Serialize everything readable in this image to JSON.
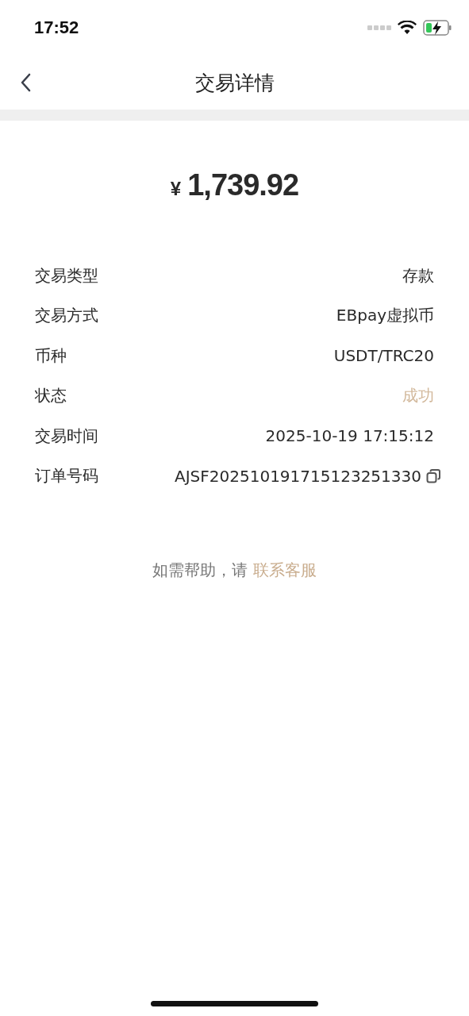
{
  "status_bar": {
    "time": "17:52"
  },
  "header": {
    "title": "交易详情"
  },
  "amount": {
    "currency": "¥",
    "value": "1,739.92"
  },
  "details": [
    {
      "label": "交易类型",
      "value": "存款",
      "kind": "plain"
    },
    {
      "label": "交易方式",
      "value": "EBpay虚拟币",
      "kind": "plain"
    },
    {
      "label": "币种",
      "value": "USDT/TRC20",
      "kind": "plain"
    },
    {
      "label": "状态",
      "value": "成功",
      "kind": "status"
    },
    {
      "label": "交易时间",
      "value": "2025-10-19 17:15:12",
      "kind": "plain"
    },
    {
      "label": "订单号码",
      "value": "AJSF202510191715123251330",
      "kind": "copy"
    }
  ],
  "help": {
    "text": "如需帮助，请",
    "link": "联系客服"
  }
}
